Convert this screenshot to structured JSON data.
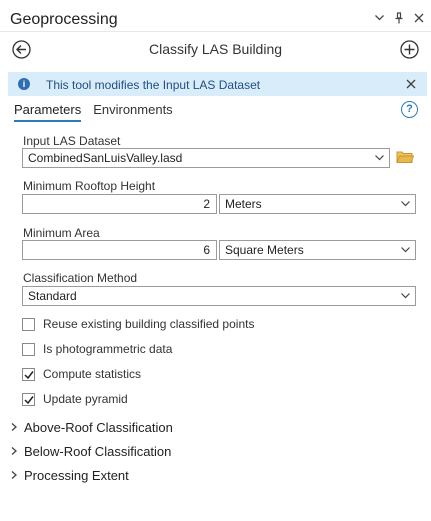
{
  "pane": {
    "title": "Geoprocessing",
    "controls": [
      "chevron-down-icon",
      "pin-icon",
      "close-icon"
    ]
  },
  "tool": {
    "title": "Classify LAS Building"
  },
  "info": {
    "text": "This tool modifies the Input LAS Dataset"
  },
  "tabs": [
    {
      "label": "Parameters",
      "active": true
    },
    {
      "label": "Environments",
      "active": false
    }
  ],
  "params": {
    "input_las": {
      "label": "Input LAS Dataset",
      "value": "CombinedSanLuisValley.lasd"
    },
    "min_rooftop": {
      "label": "Minimum Rooftop Height",
      "value": "2",
      "unit": "Meters"
    },
    "min_area": {
      "label": "Minimum Area",
      "value": "6",
      "unit": "Square Meters"
    },
    "method": {
      "label": "Classification Method",
      "value": "Standard"
    }
  },
  "checks": [
    {
      "label": "Reuse existing building classified points",
      "checked": false
    },
    {
      "label": "Is photogrammetric data",
      "checked": false
    },
    {
      "label": "Compute statistics",
      "checked": true
    },
    {
      "label": "Update pyramid",
      "checked": true
    }
  ],
  "sections": [
    {
      "label": "Above-Roof Classification"
    },
    {
      "label": "Below-Roof Classification"
    },
    {
      "label": "Processing Extent"
    }
  ],
  "colors": {
    "accent": "#2b7bb9",
    "info_bg": "#d9ecf9",
    "folder": "#e8b84a"
  }
}
